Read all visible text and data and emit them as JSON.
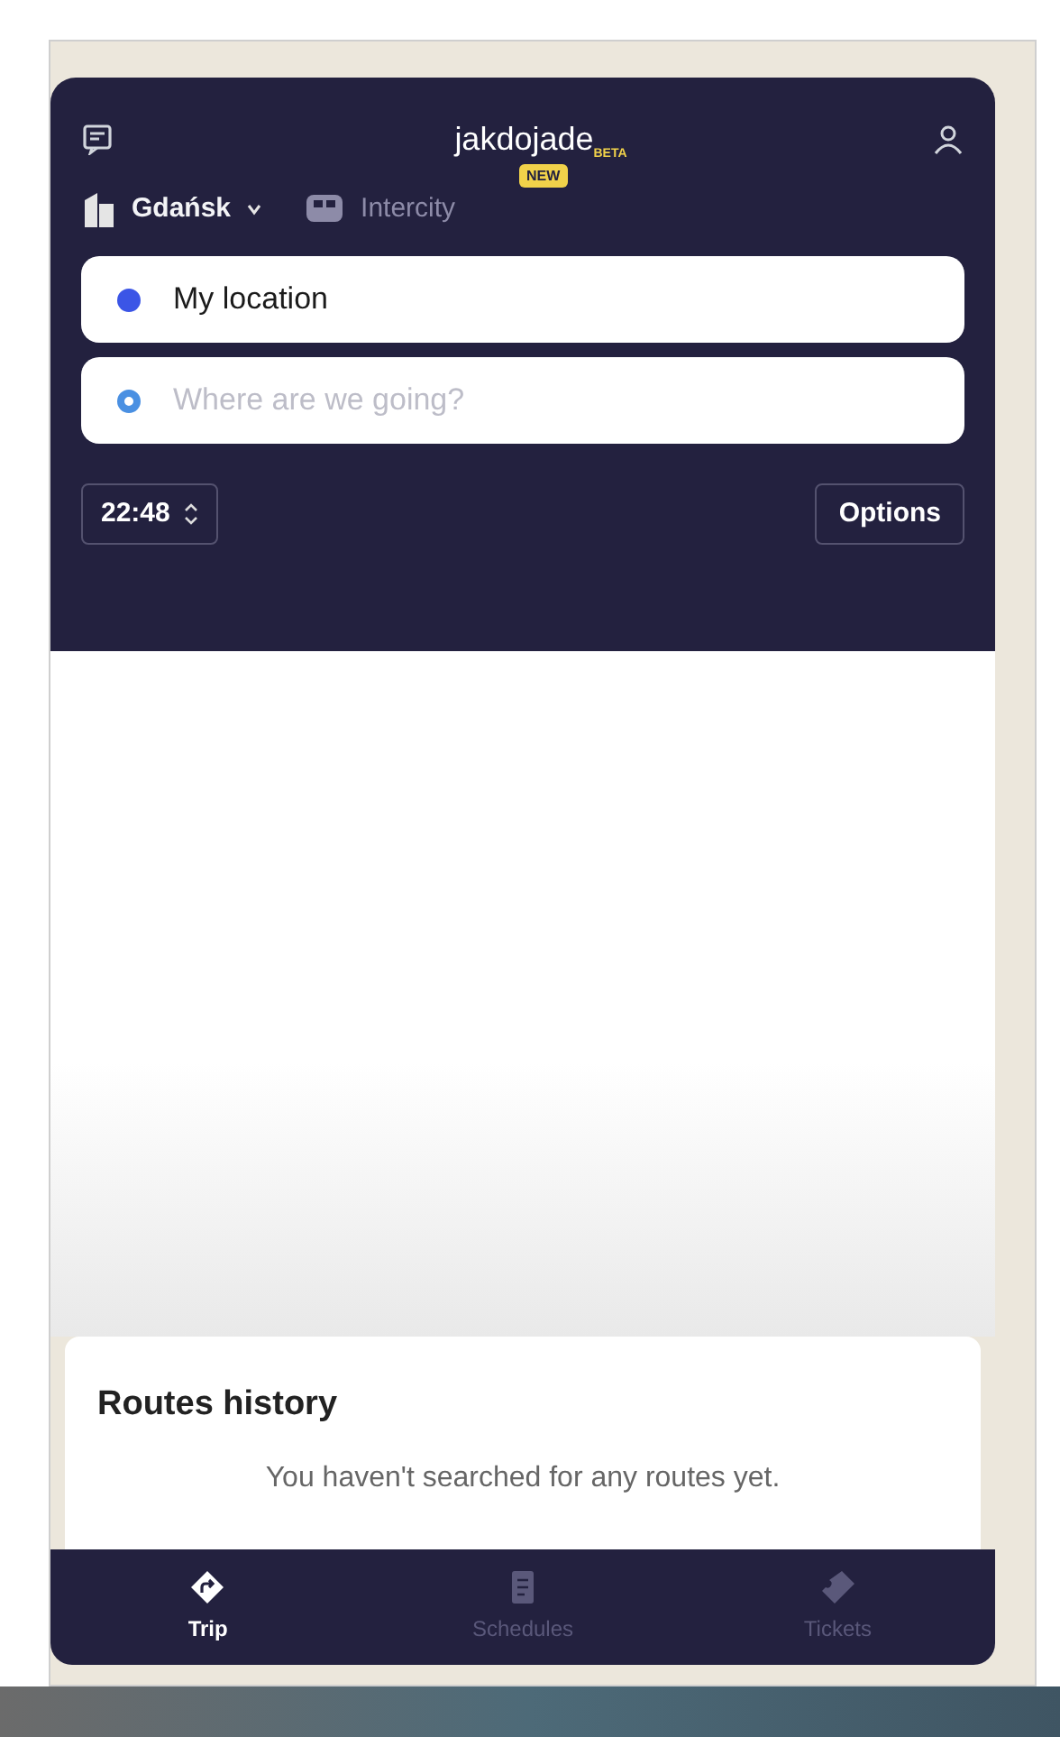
{
  "header": {
    "logo": "jakdojade",
    "logo_badge": "BETA"
  },
  "city": {
    "label": "Gdańsk"
  },
  "intercity": {
    "label": "Intercity",
    "badge": "NEW"
  },
  "from": {
    "value": "My location"
  },
  "to": {
    "placeholder": "Where are we going?"
  },
  "time": {
    "value": "22:48"
  },
  "options_button": "Options",
  "history": {
    "title": "Routes history",
    "empty_text": "You haven't searched for any routes yet."
  },
  "nav": [
    {
      "kind": "trip",
      "label": "Trip",
      "selected": true
    },
    {
      "kind": "schedules",
      "label": "Schedules",
      "selected": false
    },
    {
      "kind": "tickets",
      "label": "Tickets",
      "selected": false
    }
  ]
}
